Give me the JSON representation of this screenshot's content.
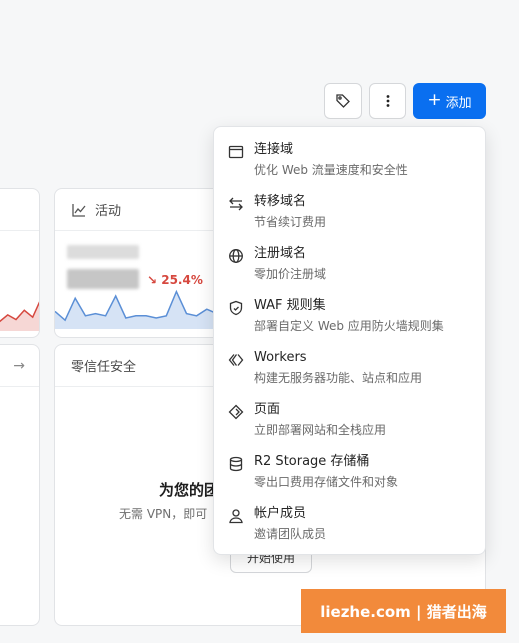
{
  "toolbar": {
    "tag_icon": "tag-icon",
    "more_icon": "more-vertical-icon",
    "add_label": "添加"
  },
  "activity_card": {
    "title": "活动",
    "delta": "25.4%",
    "sparkline": [
      0.4,
      0.2,
      0.7,
      0.3,
      0.35,
      0.3,
      0.75,
      0.25,
      0.3,
      0.3,
      0.25,
      0.3,
      0.85,
      0.35,
      0.3,
      0.45,
      0.35,
      0.3
    ]
  },
  "left_card": {
    "sparkline": [
      0.25,
      0.2,
      0.35,
      0.25,
      0.45,
      0.3,
      0.7
    ]
  },
  "zero_trust_card": {
    "title": "零信任安全",
    "heading": "为您的团",
    "subtitle": "无需 VPN，即可",
    "button_label": "开始使用"
  },
  "menu": {
    "items": [
      {
        "icon": "browser-window-icon",
        "title": "连接域",
        "desc": "优化 Web 流量速度和安全性"
      },
      {
        "icon": "transfer-arrows-icon",
        "title": "转移域名",
        "desc": "节省续订费用"
      },
      {
        "icon": "globe-icon",
        "title": "注册域名",
        "desc": "零加价注册域"
      },
      {
        "icon": "shield-icon",
        "title": "WAF 规则集",
        "desc": "部署自定义 Web 应用防火墙规则集"
      },
      {
        "icon": "workers-icon",
        "title": "Workers",
        "desc": "构建无服务器功能、站点和应用"
      },
      {
        "icon": "pages-icon",
        "title": "页面",
        "desc": "立即部署网站和全栈应用"
      },
      {
        "icon": "database-icon",
        "title": "R2 Storage 存储桶",
        "desc": "零出口费用存储文件和对象"
      },
      {
        "icon": "user-icon",
        "title": "帐户成员",
        "desc": "邀请团队成员"
      }
    ]
  },
  "watermark": {
    "text": "liezhe.com | 猎者出海"
  }
}
